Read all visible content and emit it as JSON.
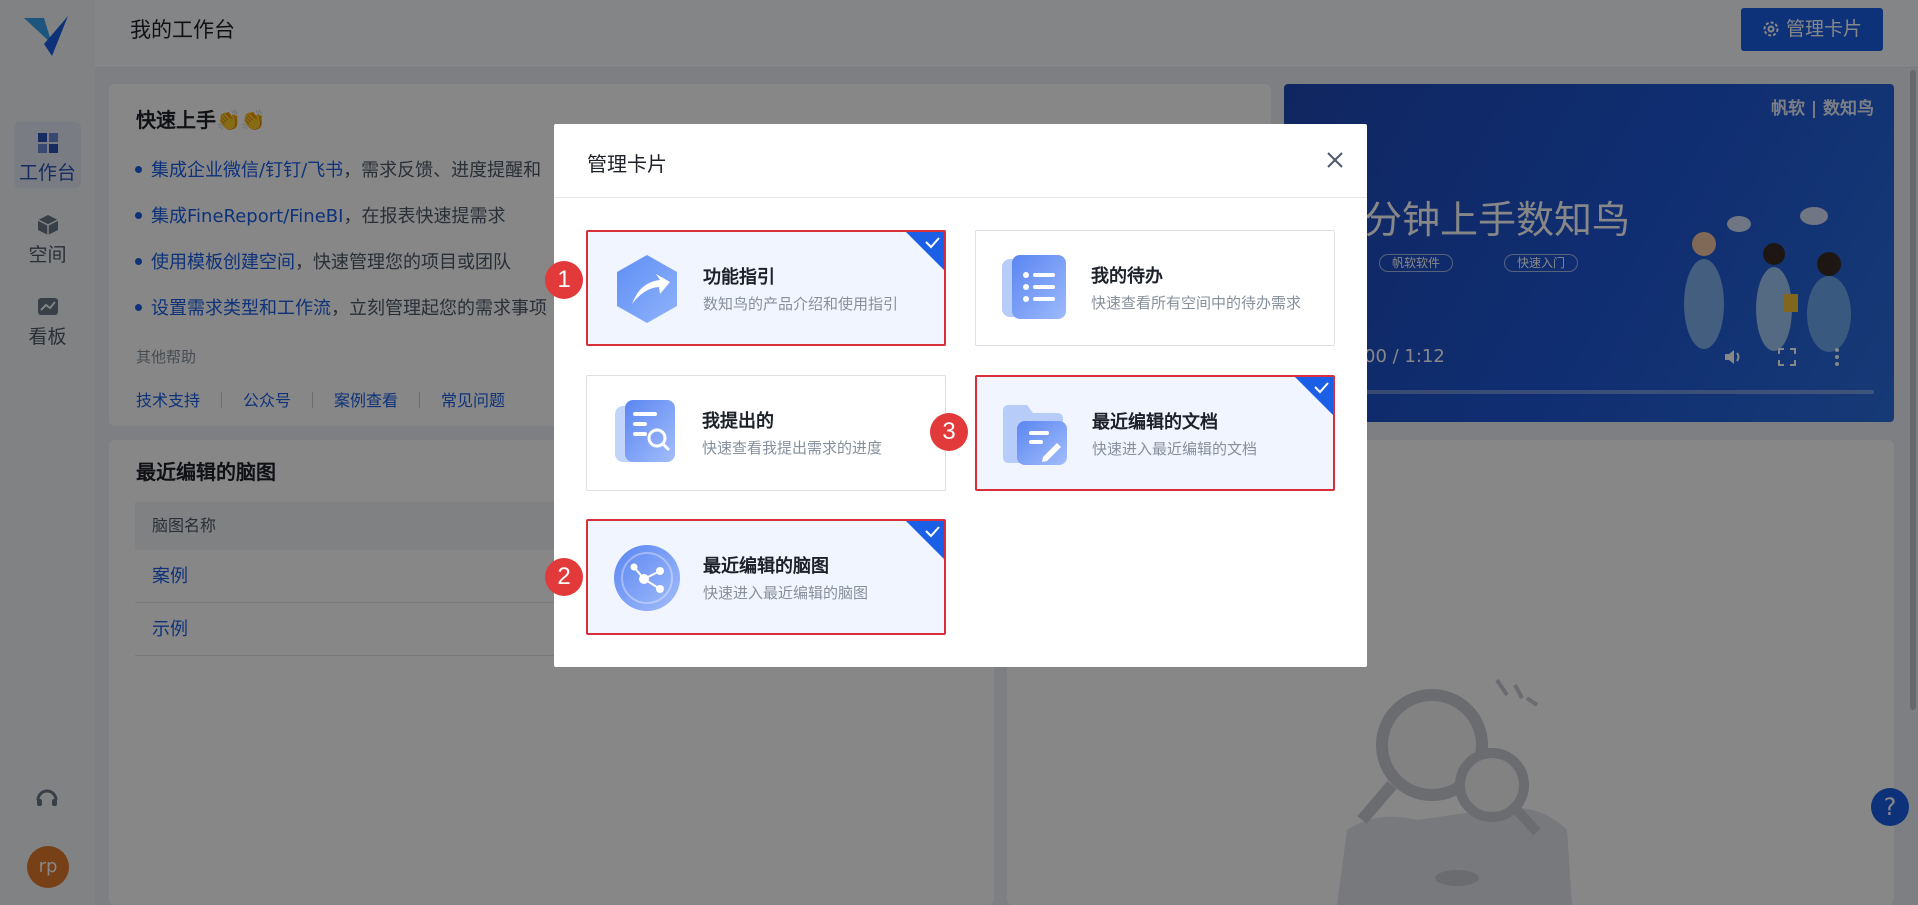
{
  "sidebar": {
    "items": [
      {
        "label": "工作台",
        "icon": "dashboard-icon",
        "active": true
      },
      {
        "label": "空间",
        "icon": "cube-icon",
        "active": false
      },
      {
        "label": "看板",
        "icon": "chart-icon",
        "active": false
      }
    ],
    "avatar_text": "rp"
  },
  "header": {
    "title": "我的工作台",
    "manage_label": "管理卡片"
  },
  "quick_start": {
    "title": "快速上手👏👏",
    "items": [
      {
        "link": "集成企业微信/钉钉/飞书",
        "rest": "，需求反馈、进度提醒和"
      },
      {
        "link": "集成FineReport/FineBI",
        "rest": "，在报表快速提需求"
      },
      {
        "link": "使用模板创建空间",
        "rest": "，快速管理您的项目或团队"
      },
      {
        "link": "设置需求类型和工作流",
        "rest": "，立刻管理起您的需求事项"
      }
    ],
    "other_help": "其他帮助",
    "help_links": [
      "技术支持",
      "公众号",
      "案例查看",
      "常见问题"
    ]
  },
  "video": {
    "brand": "帆软 | 数知鸟",
    "headline": "分钟上手数知鸟",
    "tags": [
      "帆软软件",
      "快速入门"
    ],
    "time": "00 / 1:12"
  },
  "mindmap_card": {
    "title": "最近编辑的脑图",
    "column": "脑图名称",
    "rows": [
      "案例",
      "示例"
    ]
  },
  "modal": {
    "title": "管理卡片",
    "options": [
      {
        "name": "功能指引",
        "desc": "数知鸟的产品介绍和使用指引",
        "selected": true,
        "marker": "1"
      },
      {
        "name": "我的待办",
        "desc": "快速查看所有空间中的待办需求",
        "selected": false,
        "marker": ""
      },
      {
        "name": "我提出的",
        "desc": "快速查看我提出需求的进度",
        "selected": false,
        "marker": ""
      },
      {
        "name": "最近编辑的文档",
        "desc": "快速进入最近编辑的文档",
        "selected": true,
        "marker": "3"
      },
      {
        "name": "最近编辑的脑图",
        "desc": "快速进入最近编辑的脑图",
        "selected": true,
        "marker": "2"
      }
    ]
  },
  "help_fab": "?",
  "colors": {
    "accent": "#1b5fe6",
    "marker": "#e23a3a",
    "selected_border": "#d92f3a"
  }
}
